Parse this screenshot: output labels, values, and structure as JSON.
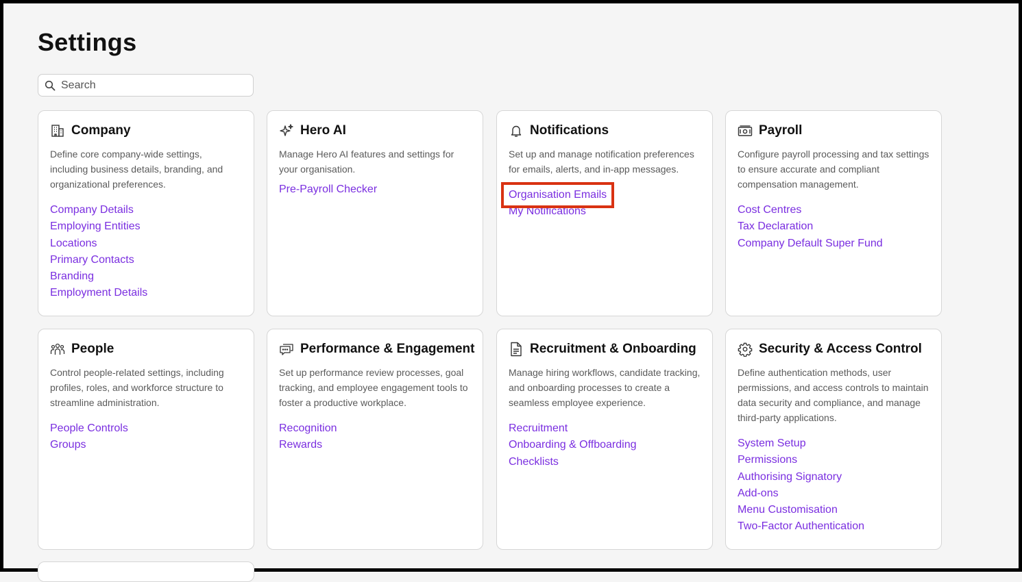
{
  "page": {
    "title": "Settings"
  },
  "search": {
    "placeholder": "Search"
  },
  "cards": [
    {
      "icon": "building-icon",
      "title": "Company",
      "description": "Define core company-wide settings, including business details, branding, and organizational preferences.",
      "links": [
        "Company Details",
        "Employing Entities",
        "Locations",
        "Primary Contacts",
        "Branding",
        "Employment Details"
      ]
    },
    {
      "icon": "sparkle-icon",
      "title": "Hero AI",
      "description": "Manage Hero AI features and settings for your organisation.",
      "links": [
        "Pre-Payroll Checker"
      ]
    },
    {
      "icon": "bell-icon",
      "title": "Notifications",
      "description": "Set up and manage notification preferences for emails, alerts, and in-app messages.",
      "links": [
        "Organisation Emails",
        "My Notifications"
      ]
    },
    {
      "icon": "cash-icon",
      "title": "Payroll",
      "description": "Configure payroll processing and tax settings to ensure accurate and compliant compensation management.",
      "links": [
        "Cost Centres",
        "Tax Declaration",
        "Company Default Super Fund"
      ]
    },
    {
      "icon": "people-icon",
      "title": "People",
      "description": "Control people-related settings, including profiles, roles, and workforce structure to streamline administration.",
      "links": [
        "People Controls",
        "Groups"
      ]
    },
    {
      "icon": "chat-icon",
      "title": "Performance & Engagement",
      "description": "Set up performance review processes, goal tracking, and employee engagement tools to foster a productive workplace.",
      "links": [
        "Recognition",
        "Rewards"
      ]
    },
    {
      "icon": "document-icon",
      "title": "Recruitment & Onboarding",
      "description": "Manage hiring workflows, candidate tracking, and onboarding processes to create a seamless employee experience.",
      "links": [
        "Recruitment",
        "Onboarding & Offboarding",
        "Checklists"
      ]
    },
    {
      "icon": "gear-icon",
      "title": "Security & Access Control",
      "description": "Define authentication methods, user permissions, and access controls to maintain data security and compliance, and manage third-party applications.",
      "links": [
        "System Setup",
        "Permissions",
        "Authorising Signatory",
        "Add-ons",
        "Menu Customisation",
        "Two-Factor Authentication"
      ]
    }
  ],
  "highlighted_link": "Organisation Emails",
  "colors": {
    "link": "#7a2ee0",
    "highlight": "#d93212"
  }
}
